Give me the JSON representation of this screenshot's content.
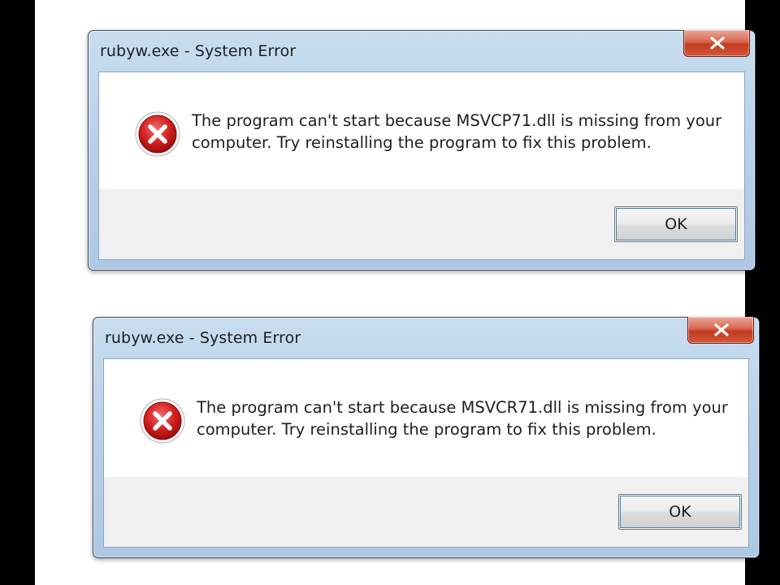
{
  "dialogs": [
    {
      "title": "rubyw.exe - System Error",
      "message_line1": "The program can't start because MSVCP71.dll is missing from your",
      "message_line2": "computer. Try reinstalling the program to fix this problem.",
      "ok_label": "OK",
      "icon": "error-icon",
      "close_icon": "close-icon"
    },
    {
      "title": "rubyw.exe - System Error",
      "message_line1": "The program can't start because MSVCR71.dll is missing from your",
      "message_line2": "computer. Try reinstalling the program to fix this problem.",
      "ok_label": "OK",
      "icon": "error-icon",
      "close_icon": "close-icon"
    }
  ],
  "colors": {
    "page_background": "#ffffff",
    "frame": "#b9d1ea",
    "close_button": "#c9452a",
    "error_icon": "#c8102e"
  }
}
